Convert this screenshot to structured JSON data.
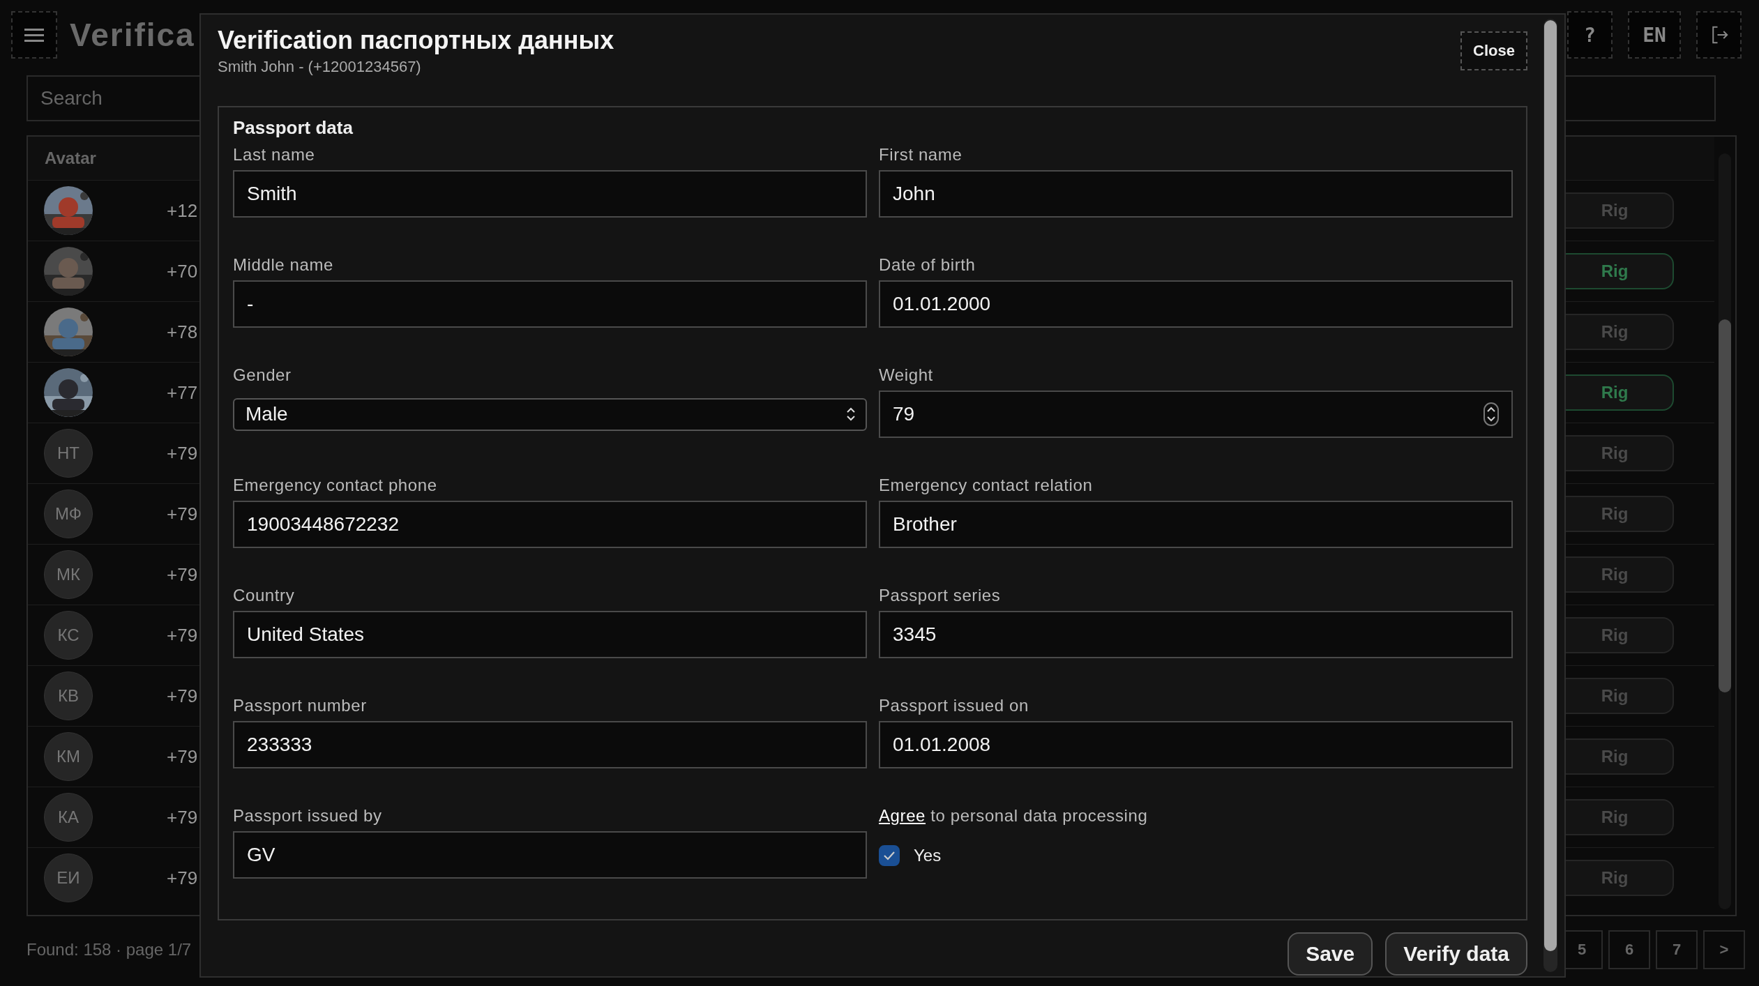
{
  "app": {
    "title": "Verifica",
    "header_buttons": [
      {
        "kind": "help",
        "label": "?"
      },
      {
        "kind": "language",
        "label": "EN"
      },
      {
        "kind": "logout"
      }
    ],
    "search": {
      "placeholder": "Search"
    },
    "table": {
      "columns": [
        "Avatar"
      ],
      "rows": [
        {
          "phone": "+12",
          "action": {
            "label": "Rig",
            "active": false
          }
        },
        {
          "phone": "+70",
          "action": {
            "label": "Rig",
            "active": true
          }
        },
        {
          "phone": "+78",
          "action": {
            "label": "Rig",
            "active": false
          }
        },
        {
          "phone": "+77",
          "action": {
            "label": "Rig",
            "active": true
          }
        },
        {
          "avatar": {
            "kind": "initials",
            "initials": "НТ"
          },
          "phone": "+79",
          "action": {
            "label": "Rig",
            "active": false
          }
        },
        {
          "avatar": {
            "kind": "initials",
            "initials": "МФ"
          },
          "phone": "+79",
          "action": {
            "label": "Rig",
            "active": false
          }
        },
        {
          "avatar": {
            "kind": "initials",
            "initials": "МК"
          },
          "phone": "+79",
          "action": {
            "label": "Rig",
            "active": false
          }
        },
        {
          "avatar": {
            "kind": "initials",
            "initials": "КС"
          },
          "phone": "+79",
          "action": {
            "label": "Rig",
            "active": false
          }
        },
        {
          "avatar": {
            "kind": "initials",
            "initials": "КВ"
          },
          "phone": "+79",
          "action": {
            "label": "Rig",
            "active": false
          }
        },
        {
          "avatar": {
            "kind": "initials",
            "initials": "КМ"
          },
          "phone": "+79",
          "action": {
            "label": "Rig",
            "active": false
          }
        },
        {
          "avatar": {
            "kind": "initials",
            "initials": "КА"
          },
          "phone": "+79",
          "action": {
            "label": "Rig",
            "active": false
          }
        },
        {
          "avatar": {
            "kind": "initials",
            "initials": "ЕИ"
          },
          "phone": "+79",
          "action": {
            "label": "Rig",
            "active": false
          }
        }
      ]
    },
    "status": "Found: 158 · page 1/7",
    "pagination": [
      "5",
      "6",
      "7",
      ">"
    ]
  },
  "dialog": {
    "title": "Verification паспортных данных",
    "subtitle": "Smith John - (+12001234567)",
    "close": "Close",
    "section": "Passport data",
    "fields": [
      {
        "kind": "text",
        "label": "Last name",
        "value": "Smith"
      },
      {
        "kind": "text",
        "label": "First name",
        "value": "John"
      },
      {
        "kind": "text",
        "label": "Middle name",
        "value": "-"
      },
      {
        "kind": "text",
        "label": "Date of birth",
        "value": "01.01.2000"
      },
      {
        "kind": "select",
        "label": "Gender",
        "value": "Male"
      },
      {
        "kind": "number",
        "label": "Weight",
        "value": "79"
      },
      {
        "kind": "text",
        "label": "Emergency contact phone",
        "value": "19003448672232"
      },
      {
        "kind": "text",
        "label": "Emergency contact relation",
        "value": "Brother"
      },
      {
        "kind": "text",
        "label": "Country",
        "value": "United States"
      },
      {
        "kind": "text",
        "label": "Passport series",
        "value": "3345"
      },
      {
        "kind": "text",
        "label": "Passport number",
        "value": "233333"
      },
      {
        "kind": "text",
        "label": "Passport issued on",
        "value": "01.01.2008"
      },
      {
        "kind": "text",
        "label": "Passport issued by",
        "value": "GV"
      }
    ],
    "agree": {
      "link": "Agree",
      "text": "to personal data processing",
      "checkbox": {
        "label": "Yes",
        "checked": true
      }
    },
    "buttons": [
      "Save",
      "Verify data"
    ]
  }
}
